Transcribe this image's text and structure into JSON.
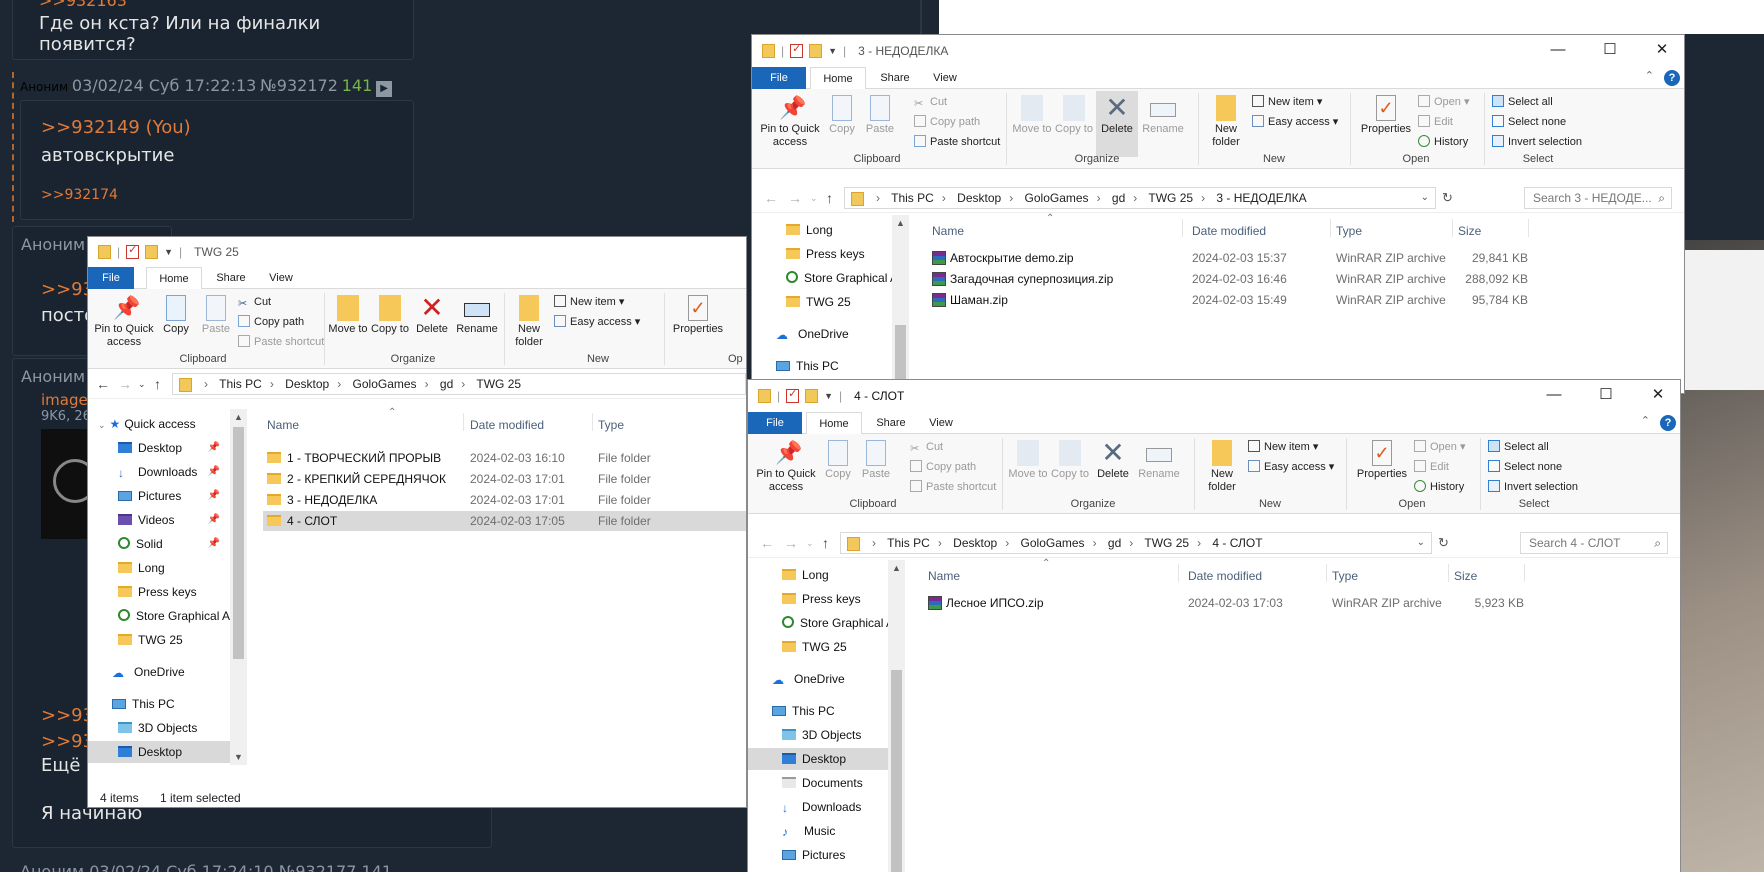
{
  "forum": {
    "post1_ref": ">>932163",
    "post1_text": "Где он кста? Или на финалки появится?",
    "post2_author": "Аноним",
    "post2_date": "03/02/24 Суб 17:22:13",
    "post2_num": "№932172",
    "post2_count": "141",
    "post2_ref": ">>932149 (You)",
    "post2_text": "автовскрытие",
    "post2_reply": ">>932174",
    "post3_author": "Аноним",
    "post3_ref": ">>932",
    "post3_text": "посто",
    "post4_author": "Аноним",
    "post4_link": "image.",
    "post4_meta": "9K6, 26",
    "post4_ref1": ">>932",
    "post4_ref2": ">>932",
    "post4_text1": "Ещё н",
    "post4_text2": "Я начинаю",
    "post5_hdr": "Аноним 03/02/24 Суб 17:24:10 №932177 141"
  },
  "win_twg": {
    "title": "TWG 25",
    "tabs": {
      "file": "File",
      "home": "Home",
      "share": "Share",
      "view": "View"
    },
    "ribbon": {
      "pin": "Pin to Quick access",
      "copy": "Copy",
      "paste": "Paste",
      "cut": "Cut",
      "copy_path": "Copy path",
      "paste_shortcut": "Paste shortcut",
      "move_to": "Move to",
      "copy_to": "Copy to",
      "delete": "Delete",
      "rename": "Rename",
      "new_folder": "New folder",
      "new_item": "New item",
      "easy_access": "Easy access",
      "properties": "Properties",
      "clipboard": "Clipboard",
      "organize": "Organize",
      "new": "New",
      "open_partial": "Op"
    },
    "address": [
      "This PC",
      "Desktop",
      "GoloGames",
      "gd",
      "TWG 25"
    ],
    "nav": [
      {
        "label": "Quick access"
      },
      {
        "label": "Desktop"
      },
      {
        "label": "Downloads"
      },
      {
        "label": "Pictures"
      },
      {
        "label": "Videos"
      },
      {
        "label": "Solid"
      },
      {
        "label": "Long"
      },
      {
        "label": "Press keys"
      },
      {
        "label": "Store Graphical A"
      },
      {
        "label": "TWG 25"
      },
      {
        "label": "OneDrive"
      },
      {
        "label": "This PC"
      },
      {
        "label": "3D Objects"
      },
      {
        "label": "Desktop"
      }
    ],
    "columns": {
      "name": "Name",
      "date": "Date modified",
      "type": "Type"
    },
    "files": [
      {
        "name": "1 - ТВОРЧЕСКИЙ ПРОРЫВ",
        "date": "2024-02-03 16:10",
        "type": "File folder"
      },
      {
        "name": "2 - КРЕПКИЙ СЕРЕДНЯЧОК",
        "date": "2024-02-03 17:01",
        "type": "File folder"
      },
      {
        "name": "3 - НЕДОДЕЛКА",
        "date": "2024-02-03 17:01",
        "type": "File folder"
      },
      {
        "name": "4 - СЛОТ",
        "date": "2024-02-03 17:05",
        "type": "File folder"
      }
    ],
    "status_items": "4 items",
    "status_selected": "1 item selected"
  },
  "win_ned": {
    "title": "3 - НЕДОДЕЛКА",
    "tabs": {
      "file": "File",
      "home": "Home",
      "share": "Share",
      "view": "View"
    },
    "ribbon": {
      "pin": "Pin to Quick access",
      "copy": "Copy",
      "paste": "Paste",
      "cut": "Cut",
      "copy_path": "Copy path",
      "paste_shortcut": "Paste shortcut",
      "move_to": "Move to",
      "copy_to": "Copy to",
      "delete": "Delete",
      "rename": "Rename",
      "new_folder": "New folder",
      "new_item": "New item",
      "easy_access": "Easy access",
      "properties": "Properties",
      "open": "Open",
      "edit": "Edit",
      "history": "History",
      "select_all": "Select all",
      "select_none": "Select none",
      "invert_selection": "Invert selection",
      "clipboard": "Clipboard",
      "organize": "Organize",
      "new": "New",
      "open_group": "Open",
      "select": "Select"
    },
    "address": [
      "This PC",
      "Desktop",
      "GoloGames",
      "gd",
      "TWG 25",
      "3 - НЕДОДЕЛКА"
    ],
    "search": "Search 3 - НЕДОДЕ...",
    "nav": [
      {
        "label": "Long"
      },
      {
        "label": "Press keys"
      },
      {
        "label": "Store Graphical A"
      },
      {
        "label": "TWG 25"
      },
      {
        "label": "OneDrive"
      },
      {
        "label": "This PC"
      }
    ],
    "columns": {
      "name": "Name",
      "date": "Date modified",
      "type": "Type",
      "size": "Size"
    },
    "files": [
      {
        "name": "Автоскрытие demo.zip",
        "date": "2024-02-03 15:37",
        "type": "WinRAR ZIP archive",
        "size": "29,841 KB"
      },
      {
        "name": "Загадочная суперпозиция.zip",
        "date": "2024-02-03 16:46",
        "type": "WinRAR ZIP archive",
        "size": "288,092 KB"
      },
      {
        "name": "Шаман.zip",
        "date": "2024-02-03 15:49",
        "type": "WinRAR ZIP archive",
        "size": "95,784 KB"
      }
    ]
  },
  "win_slot": {
    "title": "4 - СЛОТ",
    "tabs": {
      "file": "File",
      "home": "Home",
      "share": "Share",
      "view": "View"
    },
    "ribbon": {
      "pin": "Pin to Quick access",
      "copy": "Copy",
      "paste": "Paste",
      "cut": "Cut",
      "copy_path": "Copy path",
      "paste_shortcut": "Paste shortcut",
      "move_to": "Move to",
      "copy_to": "Copy to",
      "delete": "Delete",
      "rename": "Rename",
      "new_folder": "New folder",
      "new_item": "New item",
      "easy_access": "Easy access",
      "properties": "Properties",
      "open": "Open",
      "edit": "Edit",
      "history": "History",
      "select_all": "Select all",
      "select_none": "Select none",
      "invert_selection": "Invert selection",
      "clipboard": "Clipboard",
      "organize": "Organize",
      "new": "New",
      "open_group": "Open",
      "select": "Select"
    },
    "address": [
      "This PC",
      "Desktop",
      "GoloGames",
      "gd",
      "TWG 25",
      "4 - СЛОТ"
    ],
    "search": "Search 4 - СЛОТ",
    "nav": [
      {
        "label": "Long"
      },
      {
        "label": "Press keys"
      },
      {
        "label": "Store Graphical A"
      },
      {
        "label": "TWG 25"
      },
      {
        "label": "OneDrive"
      },
      {
        "label": "This PC"
      },
      {
        "label": "3D Objects"
      },
      {
        "label": "Desktop"
      },
      {
        "label": "Documents"
      },
      {
        "label": "Downloads"
      },
      {
        "label": "Music"
      },
      {
        "label": "Pictures"
      }
    ],
    "columns": {
      "name": "Name",
      "date": "Date modified",
      "type": "Type",
      "size": "Size"
    },
    "files": [
      {
        "name": "Лесное ИПСО.zip",
        "date": "2024-02-03 17:03",
        "type": "WinRAR ZIP archive",
        "size": "5,923 KB"
      }
    ]
  }
}
